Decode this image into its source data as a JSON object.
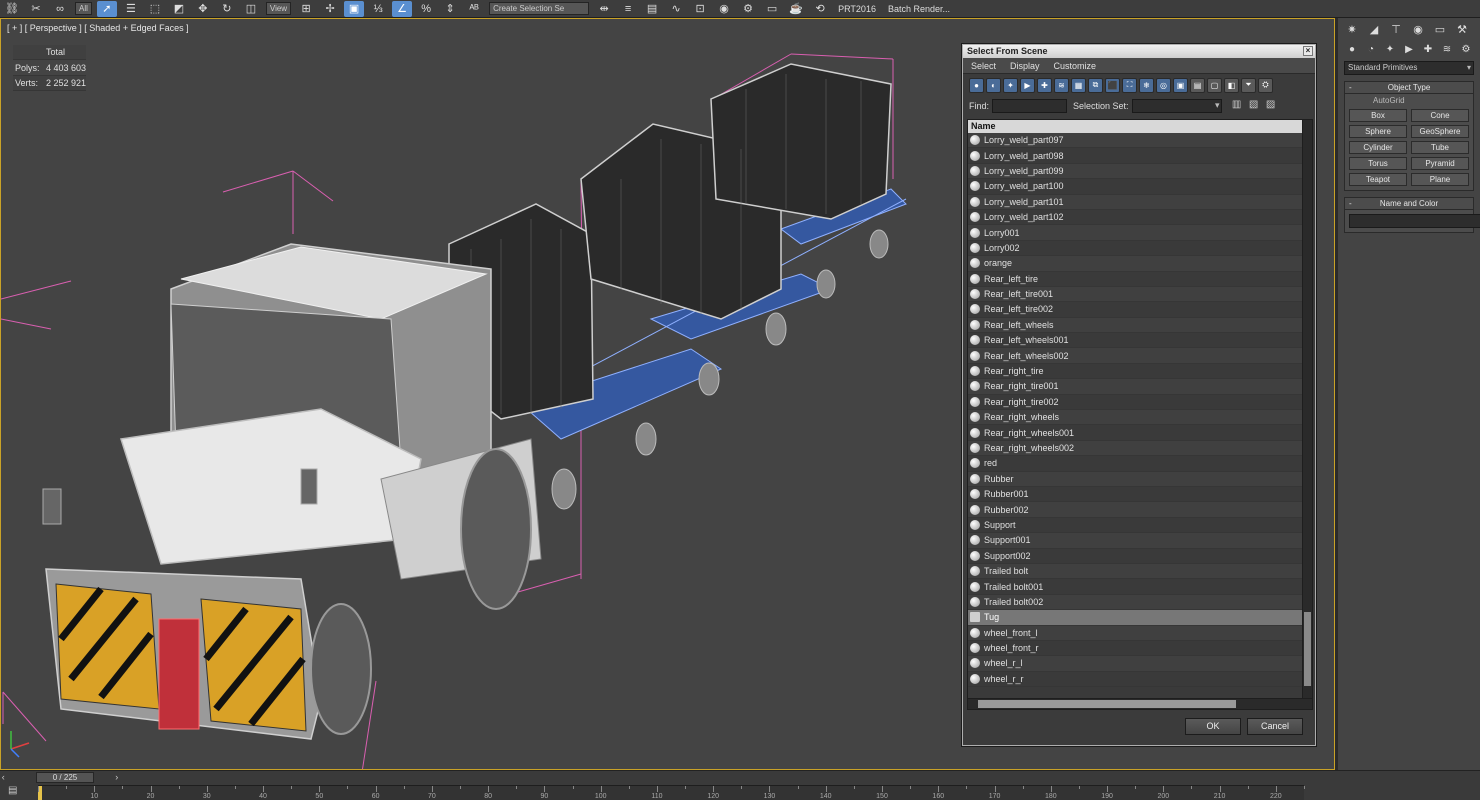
{
  "toolbar": {
    "dropdown_all": "All",
    "dropdown_view": "View",
    "selection_set": "Create Selection Se",
    "prt_label": "PRT2016",
    "batch_render": "Batch Render..."
  },
  "viewport": {
    "label": "[ + ] [ Perspective ] [ Shaded + Edged Faces ]",
    "stats": {
      "total_label": "Total",
      "polys_label": "Polys:",
      "polys_value": "4 403 603",
      "verts_label": "Verts:",
      "verts_value": "2 252 921"
    }
  },
  "dialog": {
    "title": "Select From Scene",
    "close": "×",
    "menu": [
      "Select",
      "Display",
      "Customize"
    ],
    "find_label": "Find:",
    "selection_set_label": "Selection Set:",
    "column_name": "Name",
    "items": [
      "Lorry_weld_part097",
      "Lorry_weld_part098",
      "Lorry_weld_part099",
      "Lorry_weld_part100",
      "Lorry_weld_part101",
      "Lorry_weld_part102",
      "Lorry001",
      "Lorry002",
      "orange",
      "Rear_left_tire",
      "Rear_left_tire001",
      "Rear_left_tire002",
      "Rear_left_wheels",
      "Rear_left_wheels001",
      "Rear_left_wheels002",
      "Rear_right_tire",
      "Rear_right_tire001",
      "Rear_right_tire002",
      "Rear_right_wheels",
      "Rear_right_wheels001",
      "Rear_right_wheels002",
      "red",
      "Rubber",
      "Rubber001",
      "Rubber002",
      "Support",
      "Support001",
      "Support002",
      "Trailed bolt",
      "Trailed bolt001",
      "Trailed bolt002",
      "Tug",
      "wheel_front_l",
      "wheel_front_r",
      "wheel_r_l",
      "wheel_r_r"
    ],
    "selected_item": "Tug",
    "ok": "OK",
    "cancel": "Cancel"
  },
  "command_panel": {
    "category_dropdown": "Standard Primitives",
    "object_type_title": "Object Type",
    "autogrid": "AutoGrid",
    "primitives": [
      "Box",
      "Cone",
      "Sphere",
      "GeoSphere",
      "Cylinder",
      "Tube",
      "Torus",
      "Pyramid",
      "Teapot",
      "Plane"
    ],
    "name_color_title": "Name and Color",
    "color": "#000000"
  },
  "timeline": {
    "frame_display": "0 / 225",
    "ticks": [
      "10",
      "20",
      "30",
      "40",
      "50",
      "60",
      "70",
      "80",
      "90",
      "100",
      "110",
      "120",
      "130",
      "140",
      "150",
      "160",
      "170",
      "180",
      "190",
      "200",
      "210",
      "220"
    ]
  },
  "colors": {
    "viewport_border": "#c9a227",
    "selection_highlight": "#5a8fd0",
    "wire": "#ff66cc"
  }
}
